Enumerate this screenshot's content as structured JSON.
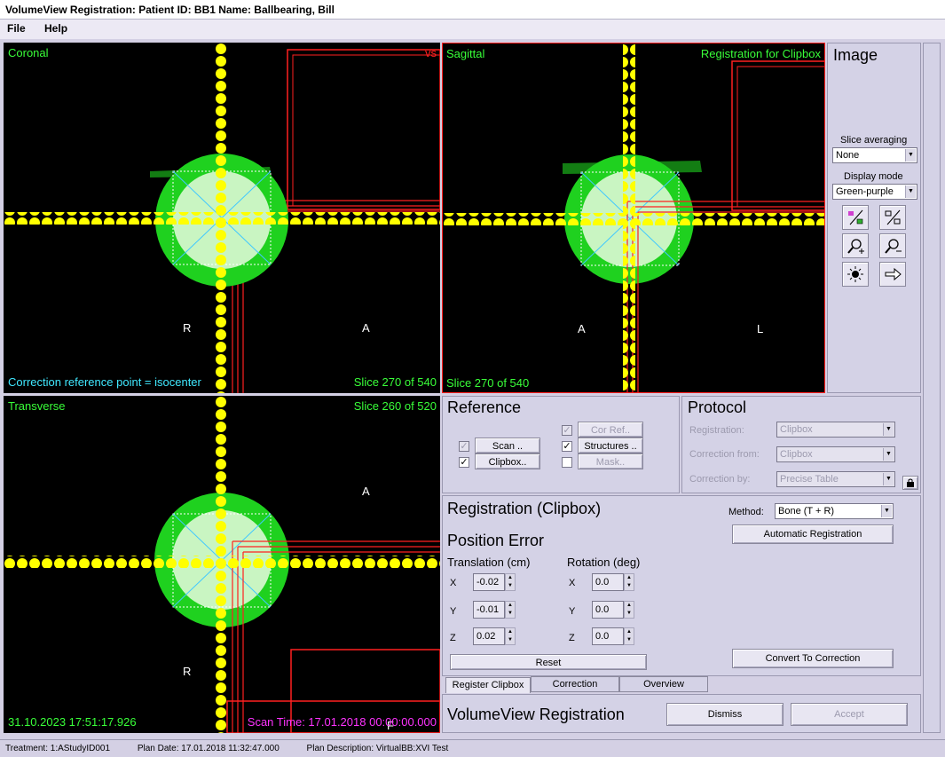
{
  "window": {
    "title": "VolumeView Registration: Patient ID: BB1   Name: Ballbearing, Bill"
  },
  "menu": {
    "items": [
      "File",
      "Help"
    ]
  },
  "viewports": {
    "coronal": {
      "label": "Coronal",
      "top_right": "vs",
      "dir_left": "R",
      "dir_right": "A",
      "bottom_left": "Correction reference point = isocenter",
      "slice": "Slice 270 of 540"
    },
    "sagittal": {
      "label": "Sagittal",
      "top_right": "Registration for Clipbox",
      "dir_left": "A",
      "dir_right": "L",
      "slice": "Slice 270 of 540"
    },
    "transverse": {
      "label": "Transverse",
      "slice": "Slice 260 of 520",
      "dir_top": "A",
      "dir_left": "R",
      "dir_bottom": "F",
      "timestamp": "31.10.2023 17:51:17.926",
      "scan_time": "Scan Time: 17.01.2018 00:00:00.000"
    }
  },
  "image_panel": {
    "title": "Image",
    "slice_averaging_label": "Slice averaging",
    "slice_averaging_value": "None",
    "display_mode_label": "Display mode",
    "display_mode_value": "Green-purple"
  },
  "reference": {
    "title": "Reference",
    "scan": "Scan ..",
    "clipbox": "Clipbox..",
    "cor_ref": "Cor Ref..",
    "structures": "Structures ..",
    "mask": "Mask.."
  },
  "protocol": {
    "title": "Protocol",
    "registration_label": "Registration:",
    "registration_value": "Clipbox",
    "correction_from_label": "Correction from:",
    "correction_from_value": "Clipbox",
    "correction_by_label": "Correction by:",
    "correction_by_value": "Precise Table"
  },
  "registration": {
    "title": "Registration (Clipbox)",
    "method_label": "Method:",
    "method_value": "Bone (T + R)",
    "auto_button": "Automatic Registration",
    "position_error": "Position Error",
    "translation_label": "Translation (cm)",
    "rotation_label": "Rotation (deg)",
    "axes": [
      "X",
      "Y",
      "Z"
    ],
    "translation": [
      "-0.02",
      "-0.01",
      "0.02"
    ],
    "rotation": [
      "0.0",
      "0.0",
      "0.0"
    ],
    "reset_button": "Reset",
    "convert_button": "Convert To Correction"
  },
  "tabs": [
    "Register Clipbox",
    "Correction",
    "Overview"
  ],
  "footer": {
    "title": "VolumeView Registration",
    "dismiss": "Dismiss",
    "accept": "Accept"
  },
  "status": {
    "treatment": "Treatment: 1:AStudyID001",
    "plan_date": "Plan Date: 17.01.2018 11:32:47.000",
    "plan_description": "Plan Description: VirtualBB:XVI Test"
  },
  "colors": {
    "viewport_text": "#39ff39",
    "dots": "#ffff00",
    "clipbox": "#ff2020",
    "sphere_outer": "#1fd11f",
    "sphere_inner": "#c9f5c2",
    "crosshair": "#40c8ff",
    "info_cyan": "#40e8ff",
    "scan_time": "#ff33ff"
  }
}
